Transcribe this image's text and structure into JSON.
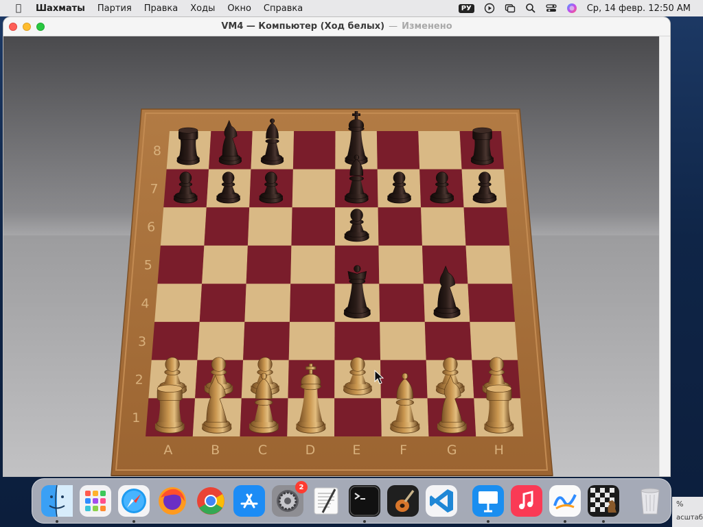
{
  "menubar": {
    "app_name": "Шахматы",
    "items": [
      "Партия",
      "Правка",
      "Ходы",
      "Окно",
      "Справка"
    ],
    "input_source": "РУ",
    "datetime": "Ср, 14 февр.  12:50 AM"
  },
  "window": {
    "title": "VM4 — Компьютер   (Ход белых)",
    "separator": "—",
    "modified": "Изменено"
  },
  "board": {
    "files": [
      "A",
      "B",
      "C",
      "D",
      "E",
      "F",
      "G",
      "H"
    ],
    "ranks": [
      "8",
      "7",
      "6",
      "5",
      "4",
      "3",
      "2",
      "1"
    ],
    "pieces": [
      {
        "color": "black",
        "type": "rook",
        "square": "a8"
      },
      {
        "color": "black",
        "type": "knight",
        "square": "b8"
      },
      {
        "color": "black",
        "type": "bishop",
        "square": "c8"
      },
      {
        "color": "black",
        "type": "king",
        "square": "e8"
      },
      {
        "color": "black",
        "type": "rook",
        "square": "h8"
      },
      {
        "color": "black",
        "type": "pawn",
        "square": "a7"
      },
      {
        "color": "black",
        "type": "pawn",
        "square": "b7"
      },
      {
        "color": "black",
        "type": "pawn",
        "square": "c7"
      },
      {
        "color": "black",
        "type": "bishop",
        "square": "e7"
      },
      {
        "color": "black",
        "type": "pawn",
        "square": "f7"
      },
      {
        "color": "black",
        "type": "pawn",
        "square": "g7"
      },
      {
        "color": "black",
        "type": "pawn",
        "square": "h7"
      },
      {
        "color": "black",
        "type": "pawn",
        "square": "e6"
      },
      {
        "color": "black",
        "type": "queen",
        "square": "e4"
      },
      {
        "color": "black",
        "type": "knight",
        "square": "g4"
      },
      {
        "color": "white",
        "type": "pawn",
        "square": "a2"
      },
      {
        "color": "white",
        "type": "pawn",
        "square": "b2"
      },
      {
        "color": "white",
        "type": "pawn",
        "square": "c2"
      },
      {
        "color": "white",
        "type": "pawn",
        "square": "e2"
      },
      {
        "color": "white",
        "type": "pawn",
        "square": "g2"
      },
      {
        "color": "white",
        "type": "pawn",
        "square": "h2"
      },
      {
        "color": "white",
        "type": "rook",
        "square": "a1"
      },
      {
        "color": "white",
        "type": "knight",
        "square": "b1"
      },
      {
        "color": "white",
        "type": "bishop",
        "square": "c1"
      },
      {
        "color": "white",
        "type": "king",
        "square": "d1"
      },
      {
        "color": "white",
        "type": "bishop",
        "square": "f1"
      },
      {
        "color": "white",
        "type": "knight",
        "square": "g1"
      },
      {
        "color": "white",
        "type": "rook",
        "square": "h1"
      }
    ]
  },
  "dock": {
    "apps": [
      "finder-icon",
      "launchpad-icon",
      "safari-icon",
      "firefox-icon",
      "chrome-icon",
      "app-store-icon",
      "system-settings-icon",
      "textedit-icon",
      "terminal-icon",
      "garageband-icon",
      "vscode-icon",
      "keynote-icon",
      "music-icon",
      "freeform-icon",
      "chess-icon",
      "trash-icon"
    ],
    "settings_badge": "2"
  },
  "colors": {
    "light_square": "#d9b985",
    "dark_square": "#7a1d2b",
    "frame": "#a9743f",
    "black_piece": "#2a1c18",
    "white_piece": "#c9964f"
  },
  "zoom_fragment": {
    "percent": "%",
    "label": "асштаб"
  }
}
